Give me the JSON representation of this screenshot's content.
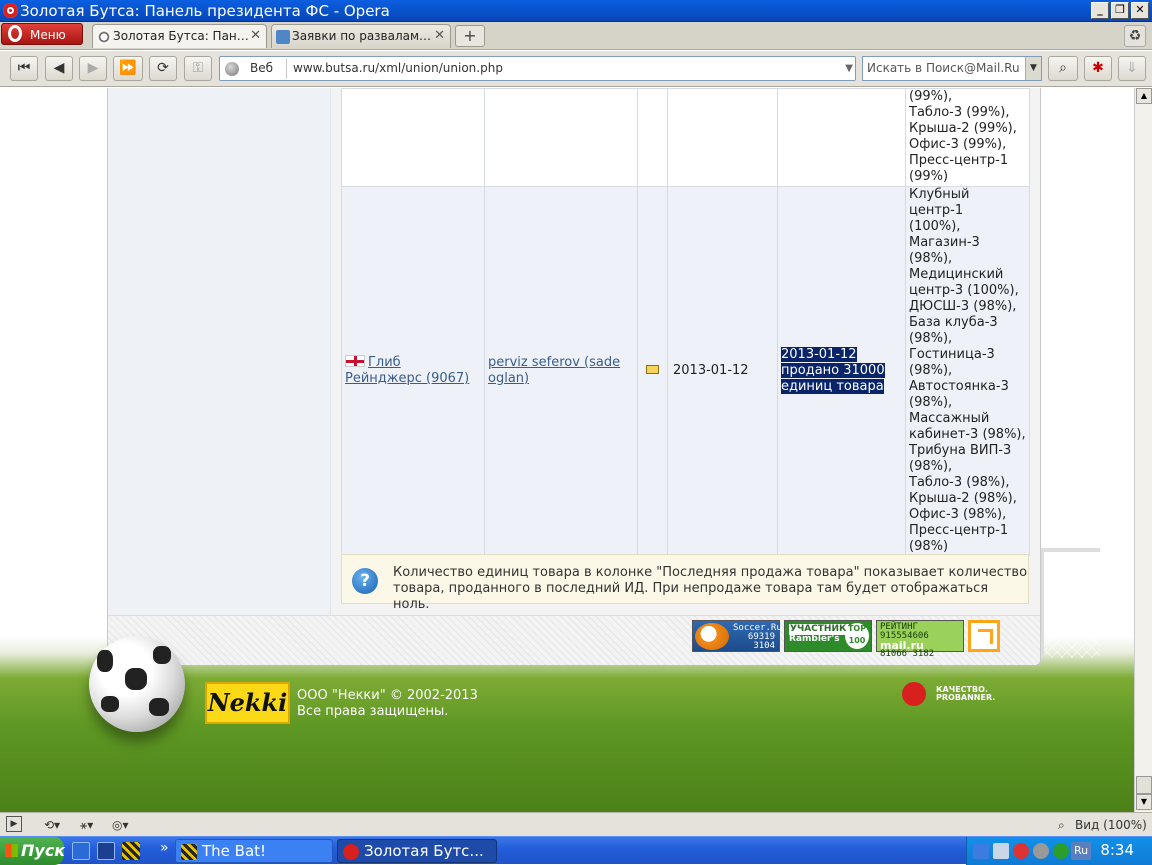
{
  "window": {
    "title": "Золотая Бутса: Панель президента ФС - Opera",
    "controls": [
      "_",
      "❐",
      "✕"
    ]
  },
  "menu_button": "Меню",
  "tabs": [
    {
      "label": "Золотая Бутса: Пан…",
      "active": true
    },
    {
      "label": "Заявки по развалам…",
      "active": false
    }
  ],
  "new_tab": "+",
  "address_bar": {
    "search_engine": "Веб",
    "url": "www.butsa.ru/xml/union/union.php"
  },
  "search_box": {
    "placeholder": "Искать в Поиск@Mail.Ru"
  },
  "table": {
    "rows": [
      {
        "club": "",
        "manager": "",
        "has_icon": false,
        "date": "",
        "last_sale": "",
        "buildings": [
          "(99%),",
          "Табло-3 (99%),",
          "Крыша-2 (99%),",
          "Офис-3 (99%),",
          "Пресс-центр-1",
          "(99%)"
        ]
      },
      {
        "club": "Глиб Рейнджерс (9067)",
        "manager": "perviz seferov (sade oglan)",
        "has_icon": true,
        "date": "2013-01-12",
        "last_sale": [
          "2013-01-12",
          "продано 31000",
          "единиц товара"
        ],
        "buildings": [
          "Клубный центр-1",
          "(100%),",
          "Магазин-3 (98%),",
          "Медицинский",
          "центр-3 (100%),",
          "ДЮСШ-3 (98%),",
          "База клуба-3",
          "(98%),",
          "Гостиница-3",
          "(98%),",
          "Автостоянка-3",
          "(98%),",
          "Массажный",
          "кабинет-3 (98%),",
          "Трибуна ВИП-3",
          "(98%),",
          "Табло-3 (98%),",
          "Крыша-2 (98%),",
          "Офис-3 (98%),",
          "Пресс-центр-1",
          "(98%)"
        ]
      }
    ]
  },
  "info_note": {
    "line1": "Количество единиц товара в колонке \"Последняя продажа товара\" показывает количество",
    "line2": "товара, проданного в последний ИД. При непродаже товара там будет отображаться ноль."
  },
  "counters": {
    "soccer": {
      "name": "Soccer.Ru",
      "v1": "69319",
      "v2": "3104"
    },
    "rambler": {
      "label": "УЧАСТНИК",
      "brand": "Rambler's",
      "top": "TOP 100"
    },
    "mailru": {
      "label": "РЕЙТИНГ",
      "id": "915554606",
      "brand": "mail.ru",
      "v1": "81066",
      "v2": "3182"
    }
  },
  "footer": {
    "nekki_logo": "Nekki",
    "copyright": "ООО \"Некки\" © 2002-2013",
    "rights": "Все права защищены.",
    "quality_line1": "КАЧЕСТВО.",
    "quality_line2": "PROBANNER."
  },
  "statusbar": {
    "zoom": "Вид (100%)"
  },
  "taskbar": {
    "start": "Пуск",
    "chevron": "»",
    "buttons": [
      {
        "label": "The Bat!",
        "active": false
      },
      {
        "label": "Золотая Бутс...",
        "active": true
      }
    ],
    "tray": {
      "lang": "Ru",
      "clock": "8:34"
    }
  },
  "colors": {
    "titlebar": "#0846b8",
    "selection": "#0a246a",
    "link": "#3a5c8c",
    "info_bg": "#fbf8e8"
  }
}
